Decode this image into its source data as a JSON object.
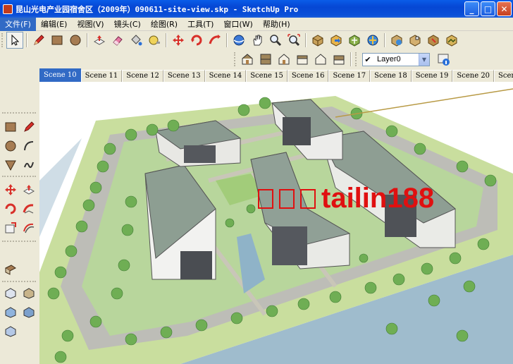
{
  "window": {
    "title": "昆山光电产业园宿舍区（2009年）090611-site-view.skp - SketchUp Pro",
    "buttons": {
      "minimize": "_",
      "maximize": "□",
      "close": "✕"
    }
  },
  "menu": [
    {
      "label": "文件(F)"
    },
    {
      "label": "编辑(E)"
    },
    {
      "label": "视图(V)"
    },
    {
      "label": "镜头(C)"
    },
    {
      "label": "绘图(R)"
    },
    {
      "label": "工具(T)"
    },
    {
      "label": "窗口(W)"
    },
    {
      "label": "帮助(H)"
    }
  ],
  "toolbar": {
    "row1_icons": [
      "select-arrow",
      "pencil",
      "rectangle",
      "circle",
      "push-pull",
      "eraser",
      "paint-bucket",
      "tape-measure",
      "move",
      "rotate",
      "follow-me",
      "offset",
      "orbit",
      "pan",
      "zoom",
      "zoom-extents",
      "get-models",
      "share-model",
      "components",
      "3d-warehouse",
      "google-earth",
      "photo-texture",
      "add-location",
      "toggle-terrain"
    ],
    "row2_icons": [
      "iso-view",
      "top-view",
      "front-view",
      "right-view",
      "back-view",
      "left-view"
    ],
    "layer": {
      "check": "✔",
      "value": "Layer0"
    }
  },
  "scenes": [
    "Scene 10",
    "Scene 11",
    "Scene 12",
    "Scene 13",
    "Scene 14",
    "Scene 15",
    "Scene 16",
    "Scene 17",
    "Scene 18",
    "Scene 19",
    "Scene 20",
    "Scene 21",
    "Sc"
  ],
  "active_scene": "Scene 10",
  "watermark": {
    "boxes": 3,
    "text": "tailin188"
  },
  "colors": {
    "titlebar": "#0a5ce8",
    "water": "#97b6ca",
    "grass": "#b6d49a",
    "road": "#b9b9b3",
    "building_roof": "#90a096",
    "watermark": "#e01010"
  }
}
